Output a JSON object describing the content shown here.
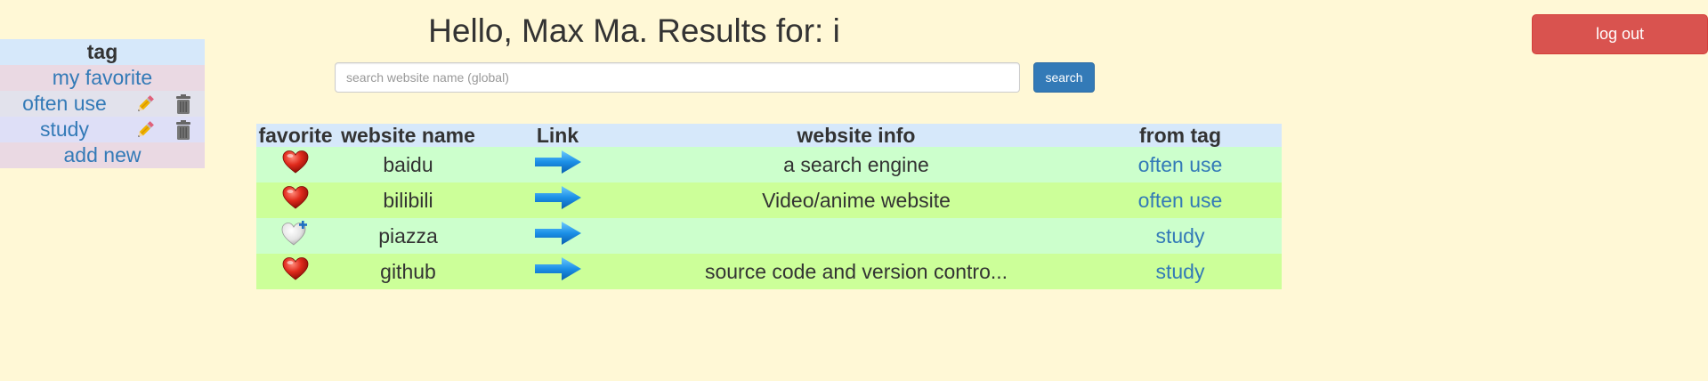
{
  "sidebar": {
    "header": "tag",
    "favorite": "my favorite",
    "tags": [
      {
        "label": "often use"
      },
      {
        "label": "study"
      }
    ],
    "add_new": "add new"
  },
  "header": {
    "title": "Hello, Max Ma. Results for: i"
  },
  "search": {
    "placeholder": "search website name (global)",
    "value": "",
    "button_label": "search"
  },
  "logout": {
    "label": "log out"
  },
  "table": {
    "columns": [
      "favorite",
      "website name",
      "Link",
      "website info",
      "from tag"
    ],
    "rows": [
      {
        "favorited": true,
        "name": "baidu",
        "info": "a search engine",
        "tag": "often use"
      },
      {
        "favorited": true,
        "name": "bilibili",
        "info": "Video/anime website",
        "tag": "often use"
      },
      {
        "favorited": false,
        "name": "piazza",
        "info": "",
        "tag": "study"
      },
      {
        "favorited": true,
        "name": "github",
        "info": "source code and version contro...",
        "tag": "study"
      }
    ]
  },
  "colors": {
    "background": "#fff8d6",
    "link": "#337ab7",
    "search_button": "#337ab7",
    "logout_button": "#d9534f",
    "row_light_green": "#ccffcc",
    "row_lime": "#ccff99",
    "header_blue": "#d6e8fa"
  },
  "icons": {
    "favorited": "heart-icon",
    "not_favorited": "heart-add-icon",
    "link": "arrow-right-icon",
    "edit": "pencil-icon",
    "delete": "trash-icon"
  }
}
